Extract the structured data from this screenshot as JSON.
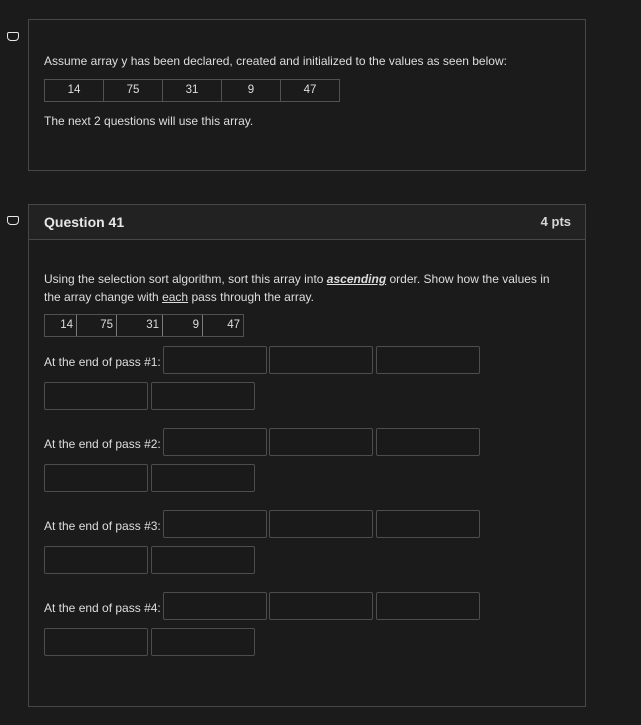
{
  "intro": {
    "text": "Assume array y has been declared, created and initialized to the values as seen below:",
    "array": [
      "14",
      "75",
      "31",
      "9",
      "47"
    ],
    "note": "The next 2 questions will use this array."
  },
  "question": {
    "title": "Question 41",
    "points": "4 pts",
    "text_before": "Using the selection sort algorithm, sort this array into ",
    "text_emph": "ascending",
    "text_mid": " order.  Show how the values in the array change with ",
    "text_each": "each",
    "text_after": " pass through the array.",
    "array": [
      "14",
      "75",
      "31",
      "9",
      "47"
    ],
    "passes": [
      {
        "label": "At the end of pass #1:"
      },
      {
        "label": "At the end of pass #2:"
      },
      {
        "label": "At the end of pass #3:"
      },
      {
        "label": "At the end of pass #4:"
      }
    ]
  },
  "colors": {
    "background": "#1b1b1b",
    "border": "#474747",
    "text": "#dedede"
  }
}
